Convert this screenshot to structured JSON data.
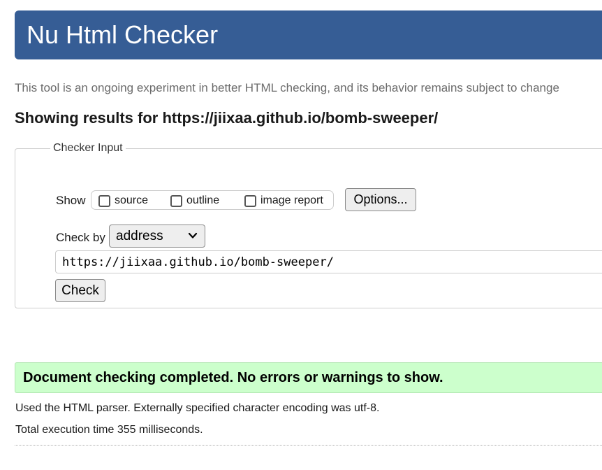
{
  "header": {
    "title": "Nu Html Checker"
  },
  "tagline": "This tool is an ongoing experiment in better HTML checking, and its behavior remains subject to change",
  "results_heading": "Showing results for https://jiixaa.github.io/bomb-sweeper/",
  "checker_input": {
    "legend": "Checker Input",
    "show_label": "Show",
    "checkboxes": [
      {
        "label": "source",
        "checked": false
      },
      {
        "label": "outline",
        "checked": false
      },
      {
        "label": "image report",
        "checked": false
      }
    ],
    "options_label": "Options...",
    "check_by_label": "Check by",
    "check_by_value": "address",
    "url_value": "https://jiixaa.github.io/bomb-sweeper/",
    "check_label": "Check"
  },
  "result": {
    "success_message": "Document checking completed. No errors or warnings to show.",
    "parser_info": "Used the HTML parser. Externally specified character encoding was utf-8.",
    "execution_time": "Total execution time 355 milliseconds."
  },
  "colors": {
    "header_bg": "#365d95",
    "success_bg": "#ccffcc"
  }
}
